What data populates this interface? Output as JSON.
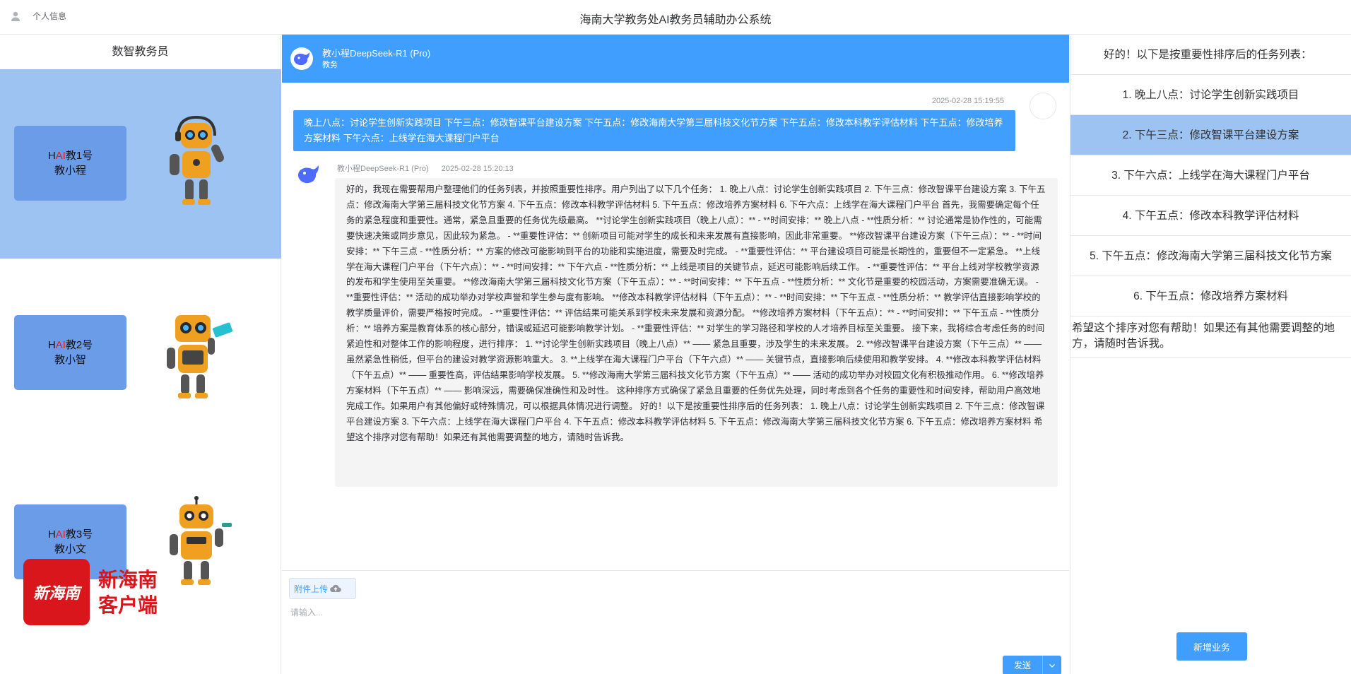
{
  "header": {
    "user_label": "个人信息",
    "title": "海南大学教务处AI教务员辅助办公系统"
  },
  "left": {
    "title": "数智教务员",
    "bots": [
      {
        "prefix": "H",
        "ai": "AI",
        "suffix": "教1号",
        "name": "教小程",
        "active": true
      },
      {
        "prefix": "H",
        "ai": "AI",
        "suffix": "教2号",
        "name": "教小智",
        "active": false
      },
      {
        "prefix": "H",
        "ai": "AI",
        "suffix": "教3号",
        "name": "教小文",
        "active": false
      }
    ],
    "logo_glyph": "新海南",
    "logo_line1": "新海南",
    "logo_line2": "客户端"
  },
  "chat": {
    "header_name": "教小程DeepSeek-R1 (Pro)",
    "header_sub": "教务",
    "user_time": "2025-02-28 15:19:55",
    "user_message": "晚上八点：讨论学生创新实践项目 下午三点：修改智课平台建设方案 下午五点：修改海南大学第三届科技文化节方案 下午五点：修改本科教学评估材料 下午五点：修改培养方案材料 下午六点：上线学在海大课程门户平台",
    "bot_name": "教小程DeepSeek-R1 (Pro)",
    "bot_time": "2025-02-28 15:20:13",
    "bot_message": "好的，我现在需要帮用户整理他们的任务列表，并按照重要性排序。用户列出了以下几个任务： 1. 晚上八点：讨论学生创新实践项目 2. 下午三点：修改智课平台建设方案 3. 下午五点：修改海南大学第三届科技文化节方案 4. 下午五点：修改本科教学评估材料 5. 下午五点：修改培养方案材料 6. 下午六点：上线学在海大课程门户平台 首先，我需要确定每个任务的紧急程度和重要性。通常，紧急且重要的任务优先级最高。 **讨论学生创新实践项目（晚上八点）：** - **时间安排：** 晚上八点 - **性质分析：** 讨论通常是协作性的，可能需要快速决策或同步意见，因此较为紧急。 - **重要性评估：** 创新项目可能对学生的成长和未来发展有直接影响，因此非常重要。 **修改智课平台建设方案（下午三点）：** - **时间安排：** 下午三点 - **性质分析：** 方案的修改可能影响到平台的功能和实施进度，需要及时完成。 - **重要性评估：** 平台建设项目可能是长期性的，重要但不一定紧急。 **上线学在海大课程门户平台（下午六点）：** - **时间安排：** 下午六点 - **性质分析：** 上线是项目的关键节点，延迟可能影响后续工作。 - **重要性评估：** 平台上线对学校教学资源的发布和学生使用至关重要。 **修改海南大学第三届科技文化节方案（下午五点）：** - **时间安排：** 下午五点 - **性质分析：** 文化节是重要的校园活动，方案需要准确无误。 - **重要性评估：** 活动的成功举办对学校声誉和学生参与度有影响。 **修改本科教学评估材料（下午五点）：** - **时间安排：** 下午五点 - **性质分析：** 教学评估直接影响学校的教学质量评价，需要严格按时完成。 - **重要性评估：** 评估结果可能关系到学校未来发展和资源分配。 **修改培养方案材料（下午五点）：** - **时间安排：** 下午五点 - **性质分析：** 培养方案是教育体系的核心部分，错误或延迟可能影响教学计划。 - **重要性评估：** 对学生的学习路径和学校的人才培养目标至关重要。 接下来，我将综合考虑任务的时间紧迫性和对整体工作的影响程度，进行排序： 1. **讨论学生创新实践项目（晚上八点）** —— 紧急且重要，涉及学生的未来发展。 2. **修改智课平台建设方案（下午三点）** —— 虽然紧急性稍低，但平台的建设对教学资源影响重大。 3. **上线学在海大课程门户平台（下午六点）** —— 关键节点，直接影响后续使用和教学安排。 4. **修改本科教学评估材料（下午五点）** —— 重要性高，评估结果影响学校发展。 5. **修改海南大学第三届科技文化节方案（下午五点）** —— 活动的成功举办对校园文化有积极推动作用。 6. **修改培养方案材料（下午五点）** —— 影响深远，需要确保准确性和及时性。 这种排序方式确保了紧急且重要的任务优先处理，同时考虑到各个任务的重要性和时间安排，帮助用户高效地完成工作。如果用户有其他偏好或特殊情况，可以根据具体情况进行调整。 好的！以下是按重要性排序后的任务列表： 1. 晚上八点：讨论学生创新实践项目 2. 下午三点：修改智课平台建设方案 3. 下午六点：上线学在海大课程门户平台 4. 下午五点：修改本科教学评估材料 5. 下午五点：修改海南大学第三届科技文化节方案 6. 下午五点：修改培养方案材料 希望这个排序对您有帮助！如果还有其他需要调整的地方，请随时告诉我。",
    "upload_label": "附件上传",
    "input_placeholder": "请输入...",
    "send_label": "发送"
  },
  "right": {
    "heading": "好的！以下是按重要性排序后的任务列表：",
    "tasks": [
      {
        "label": "1. 晚上八点：讨论学生创新实践项目",
        "active": false
      },
      {
        "label": "2. 下午三点：修改智课平台建设方案",
        "active": true
      },
      {
        "label": "3. 下午六点：上线学在海大课程门户平台",
        "active": false
      },
      {
        "label": "4. 下午五点：修改本科教学评估材料",
        "active": false
      },
      {
        "label": "5. 下午五点：修改海南大学第三届科技文化节方案",
        "active": false
      },
      {
        "label": "6. 下午五点：修改培养方案材料",
        "active": false
      }
    ],
    "footer": "希望这个排序对您有帮助！如果还有其他需要调整的地方，请随时告诉我。",
    "new_button": "新增业务"
  },
  "colors": {
    "primary": "#409eff",
    "active_bg": "#9cc3f2",
    "bot_button": "#6a9ce8",
    "brand_red": "#d8161b"
  }
}
